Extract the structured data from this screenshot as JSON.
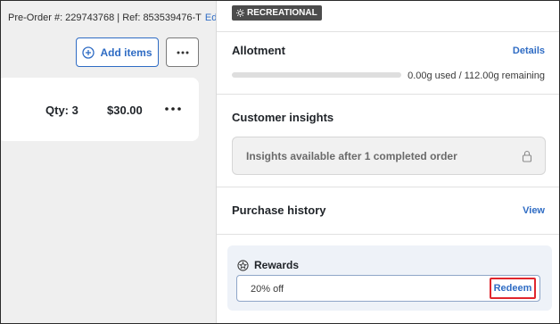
{
  "order": {
    "meta": "Pre-Order #: 229743768 | Ref: 853539476-T",
    "edit_label": "Edit",
    "add_items_label": "Add items"
  },
  "item": {
    "qty": "Qty: 3",
    "price": "$30.00"
  },
  "sidebar": {
    "badge": "RECREATIONAL",
    "allotment": {
      "title": "Allotment",
      "details_label": "Details",
      "usage_text": "0.00g used / 112.00g remaining",
      "used_fraction": 0
    },
    "insights": {
      "title": "Customer insights",
      "message": "Insights available after 1 completed order"
    },
    "purchase_history": {
      "title": "Purchase history",
      "view_label": "View"
    },
    "rewards": {
      "title": "Rewards",
      "value": "20% off",
      "redeem_label": "Redeem"
    }
  },
  "colors": {
    "accent": "#2f6cc4",
    "highlight": "#e0262d",
    "badge_bg": "#4c4c4c"
  }
}
